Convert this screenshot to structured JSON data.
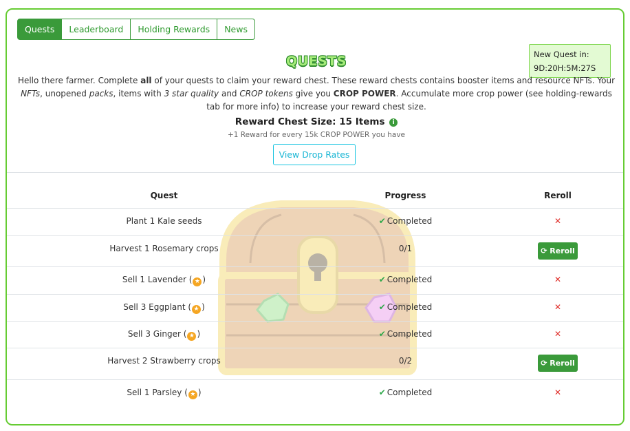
{
  "tabs": [
    {
      "label": "Quests",
      "active": true
    },
    {
      "label": "Leaderboard",
      "active": false
    },
    {
      "label": "Holding Rewards",
      "active": false
    },
    {
      "label": "News",
      "active": false
    }
  ],
  "timer": {
    "label": "New Quest in:",
    "value": "9D:20H:5M:27S"
  },
  "title": "QUESTS",
  "intro": {
    "p1": "Hello there farmer. Complete ",
    "all": "all",
    "p2": " of your quests to claim your reward chest. These reward chests contains booster items and resource NFTs. Your ",
    "nfts": "NFTs",
    "p3": ", unopened ",
    "packs": "packs",
    "p4": ", items with ",
    "star_quality": "3 star quality",
    "p5": " and ",
    "crop_tokens": "CROP tokens",
    "p6": " give you ",
    "crop_power": "CROP POWER",
    "p7": ". Accumulate more crop power (see holding-rewards tab for more info) to increase your reward chest size."
  },
  "chest": {
    "size_label": "Reward Chest Size: 15 Items",
    "sub": "+1 Reward for every 15k CROP POWER you have"
  },
  "drop_button": "View Drop Rates",
  "table": {
    "headers": {
      "quest": "Quest",
      "progress": "Progress",
      "reroll": "Reroll"
    },
    "rows": [
      {
        "quest": "Plant 1 Kale seeds",
        "star": false,
        "progress": "Completed",
        "completed": true,
        "reroll": "none"
      },
      {
        "quest": "Harvest 1 Rosemary crops",
        "star": false,
        "progress": "0/1",
        "completed": false,
        "reroll": "Reroll"
      },
      {
        "quest": "Sell 1 Lavender (",
        "star": true,
        "progress": "Completed",
        "completed": true,
        "reroll": "none"
      },
      {
        "quest": "Sell 3 Eggplant (",
        "star": true,
        "progress": "Completed",
        "completed": true,
        "reroll": "none"
      },
      {
        "quest": "Sell 3 Ginger (",
        "star": true,
        "progress": "Completed",
        "completed": true,
        "reroll": "none"
      },
      {
        "quest": "Harvest 2 Strawberry crops",
        "star": false,
        "progress": "0/2",
        "completed": false,
        "reroll": "Reroll"
      },
      {
        "quest": "Sell 1 Parsley (",
        "star": true,
        "progress": "Completed",
        "completed": true,
        "reroll": "none"
      }
    ]
  },
  "colors": {
    "brand_green": "#3a9a3a",
    "border_green": "#66cc33",
    "danger": "#e0302c",
    "info": "#17c4e0"
  },
  "icons": {
    "check": "check-icon",
    "star": "star-icon",
    "x": "x-icon",
    "info": "info-icon",
    "reroll": "refresh-icon"
  }
}
